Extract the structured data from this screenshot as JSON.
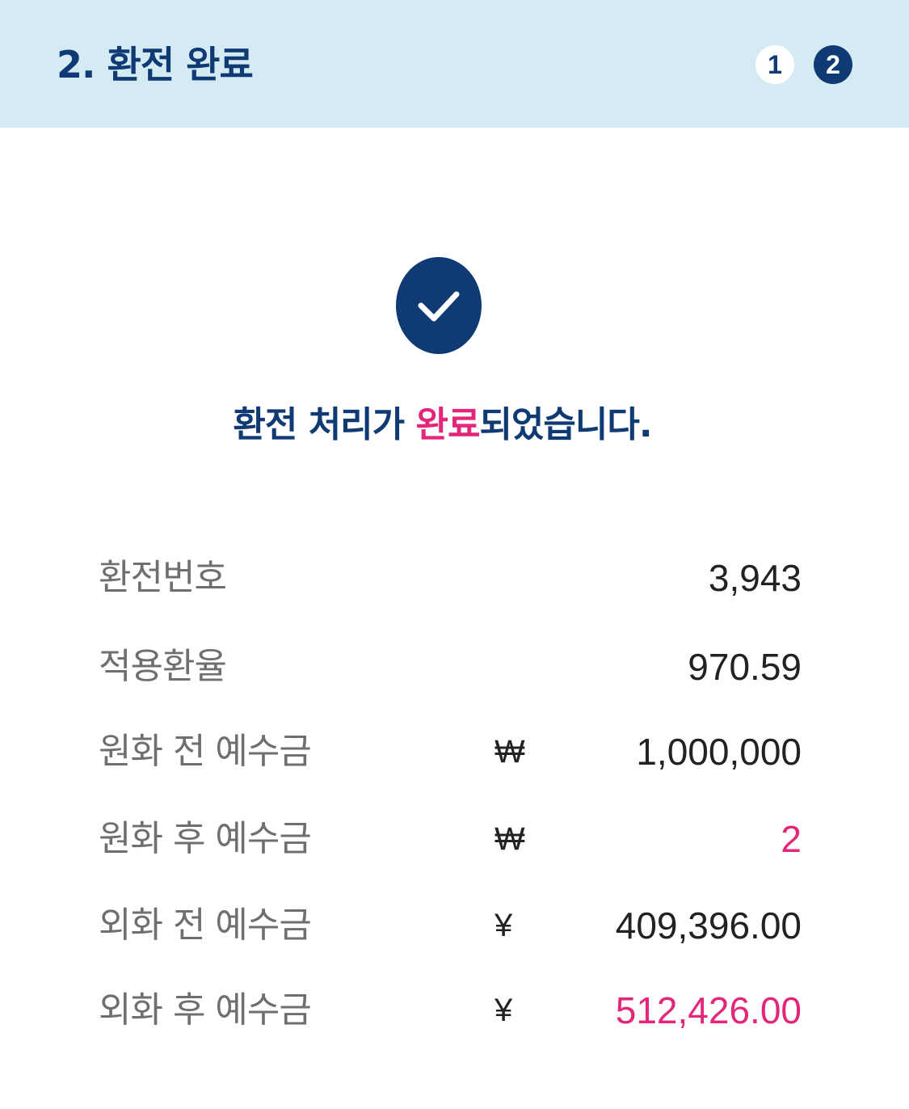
{
  "header": {
    "title": "2. 환전 완료",
    "steps": [
      "1",
      "2"
    ],
    "current_step": 2
  },
  "status_icon": "checkmark-icon",
  "message": {
    "before": "환전 처리가 ",
    "accent": "완료",
    "after": "되었습니다."
  },
  "details": [
    {
      "label": "환전번호",
      "currency": "",
      "value": "3,943"
    },
    {
      "label": "적용환율",
      "currency": "",
      "value": "970.59"
    },
    {
      "label": "원화 전 예수금",
      "currency": "₩",
      "value": "1,000,000"
    },
    {
      "label": "원화 후 예수금",
      "currency": "₩",
      "value": "2"
    },
    {
      "label": "외화 전 예수금",
      "currency": "¥",
      "value": "409,396.00"
    },
    {
      "label": "외화 후 예수금",
      "currency": "¥",
      "value": "512,426.00"
    }
  ],
  "colors": {
    "header_bg": "#d5ebf4",
    "primary": "#0f3a73",
    "accent": "#e3267a",
    "label": "#6f6f6f",
    "value": "#222222"
  }
}
